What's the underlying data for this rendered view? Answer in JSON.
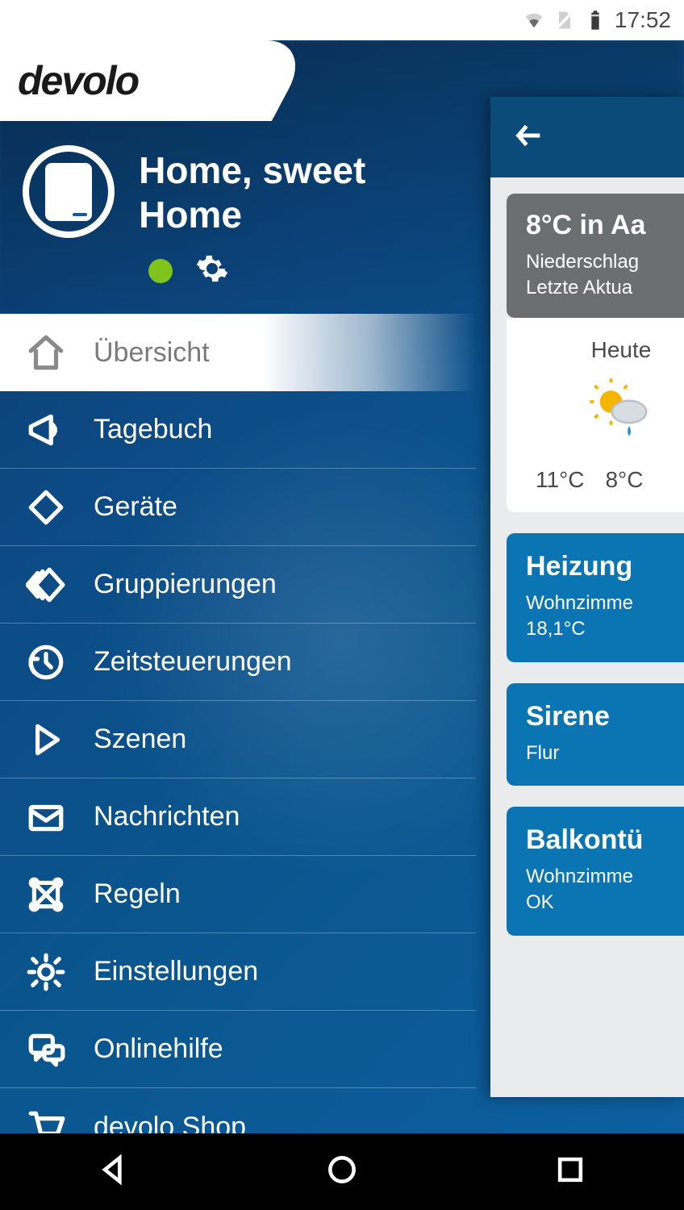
{
  "status_bar": {
    "time": "17:52"
  },
  "brand": "devolo",
  "drawer": {
    "title": "Home, sweet Home",
    "status_color": "#7fc41c"
  },
  "nav": {
    "items": [
      {
        "label": "Übersicht",
        "active": true
      },
      {
        "label": "Tagebuch"
      },
      {
        "label": "Geräte"
      },
      {
        "label": "Gruppierungen"
      },
      {
        "label": "Zeitsteuerungen"
      },
      {
        "label": "Szenen"
      },
      {
        "label": "Nachrichten"
      },
      {
        "label": "Regeln"
      },
      {
        "label": "Einstellungen"
      },
      {
        "label": "Onlinehilfe"
      },
      {
        "label": "devolo Shop"
      }
    ]
  },
  "peek": {
    "weather": {
      "title": "8°C in Aa",
      "line1": "Niederschlag",
      "line2": "Letzte Aktua"
    },
    "forecast": {
      "label": "Heute",
      "high": "11°C",
      "low": "8°C"
    },
    "tiles": [
      {
        "title": "Heizung",
        "line1": "Wohnzimme",
        "line2": "18,1°C"
      },
      {
        "title": "Sirene",
        "line1": "Flur",
        "line2": ""
      },
      {
        "title": "Balkontü",
        "line1": "Wohnzimme",
        "line2": "OK"
      }
    ]
  }
}
